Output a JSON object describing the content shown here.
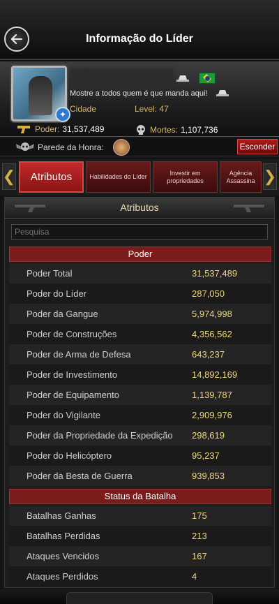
{
  "header": {
    "title": "Informação do Líder"
  },
  "profile": {
    "motto": "Mostre a todos quem é que manda aqui!",
    "city_label": "Cidade",
    "level": "Level: 47",
    "power_label": "Poder:",
    "power_value": "31,537,489",
    "deaths_label": "Mortes:",
    "deaths_value": "1,107,736"
  },
  "hall_of_fame": {
    "label": "Parede da Honra:",
    "hide_button": "Esconder"
  },
  "tabs": [
    {
      "label": "Atributos",
      "active": true
    },
    {
      "label": "Habilidades do Líder"
    },
    {
      "label": "Investir em propriedades"
    },
    {
      "label": "Agência Assassina"
    }
  ],
  "panel": {
    "title": "Atributos",
    "search_placeholder": "Pesquisa",
    "sections": [
      {
        "header": "Poder",
        "rows": [
          {
            "label": "Poder Total",
            "value": "31,537,489"
          },
          {
            "label": "Poder do Líder",
            "value": "287,050"
          },
          {
            "label": "Poder da Gangue",
            "value": "5,974,998"
          },
          {
            "label": "Poder de Construções",
            "value": "4,356,562"
          },
          {
            "label": "Poder de Arma de Defesa",
            "value": "643,237"
          },
          {
            "label": "Poder de Investimento",
            "value": "14,892,169"
          },
          {
            "label": "Poder de Equipamento",
            "value": "1,139,787"
          },
          {
            "label": "Poder do Vigilante",
            "value": "2,909,976"
          },
          {
            "label": "Poder da Propriedade da Expedição",
            "value": "298,619"
          },
          {
            "label": "Poder do Helicóptero",
            "value": "95,237"
          },
          {
            "label": "Poder da Besta de Guerra",
            "value": "939,853"
          }
        ]
      },
      {
        "header": "Status da Batalha",
        "rows": [
          {
            "label": "Batalhas Ganhas",
            "value": "175"
          },
          {
            "label": "Batalhas Perdidas",
            "value": "213"
          },
          {
            "label": "Ataques Vencidos",
            "value": "167"
          },
          {
            "label": "Ataques Perdidos",
            "value": "4"
          }
        ]
      }
    ]
  }
}
